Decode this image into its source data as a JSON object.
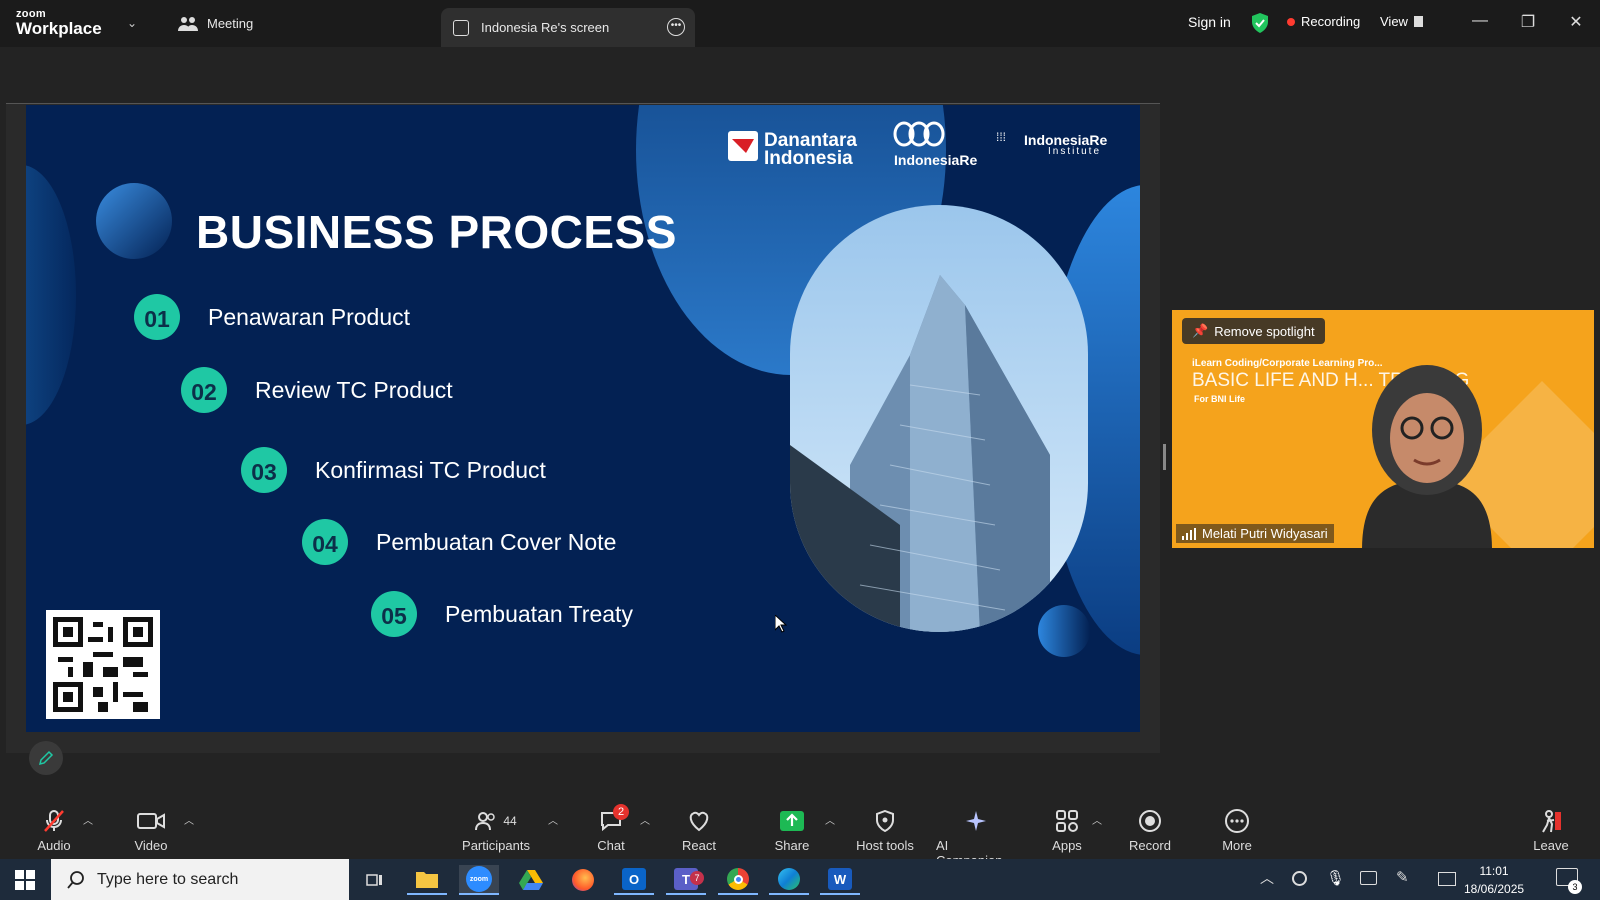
{
  "app": {
    "brand_small": "zoom",
    "brand_big": "Workplace"
  },
  "tabs": {
    "meeting": "Meeting",
    "share": "Indonesia Re's screen"
  },
  "topbar": {
    "sign_in": "Sign in",
    "recording": "Recording",
    "view": "View"
  },
  "slide": {
    "title": "BUSINESS PROCESS",
    "steps": [
      {
        "num": "01",
        "label": "Penawaran Product"
      },
      {
        "num": "02",
        "label": "Review TC Product"
      },
      {
        "num": "03",
        "label": "Konfirmasi TC Product"
      },
      {
        "num": "04",
        "label": "Pembuatan Cover Note"
      },
      {
        "num": "05",
        "label": "Pembuatan Treaty"
      }
    ],
    "logos": {
      "danantara_1": "Danantara",
      "danantara_2": "Indonesia",
      "indonesiare": "IndonesiaRe",
      "institute_1": "IndonesiaRe",
      "institute_2": "Institute"
    }
  },
  "video": {
    "remove_spotlight": "Remove spotlight",
    "participant_name": "Melati Putri Widyasari",
    "bg_sub": "iLearn Coding/Corporate Learning Pro...",
    "bg_title": "BASIC LIFE AND H... TRAINING",
    "bg_for": "For BNI Life"
  },
  "toolbar": {
    "audio": "Audio",
    "video": "Video",
    "participants": "Participants",
    "participants_count": "44",
    "chat": "Chat",
    "chat_badge": "2",
    "react": "React",
    "share": "Share",
    "host_tools": "Host tools",
    "ai_companion": "AI Companion",
    "apps": "Apps",
    "record": "Record",
    "more": "More",
    "leave": "Leave"
  },
  "taskbar": {
    "search_placeholder": "Type here to search",
    "time": "11:01",
    "date": "18/06/2025",
    "notif_count": "3",
    "teams_badge": "7"
  },
  "colors": {
    "slide_bg": "#032153",
    "step_circle": "#1fc8a4",
    "tile_bg": "#f5a31c",
    "share_green": "#1db954",
    "rec_red": "#ff3b30"
  }
}
